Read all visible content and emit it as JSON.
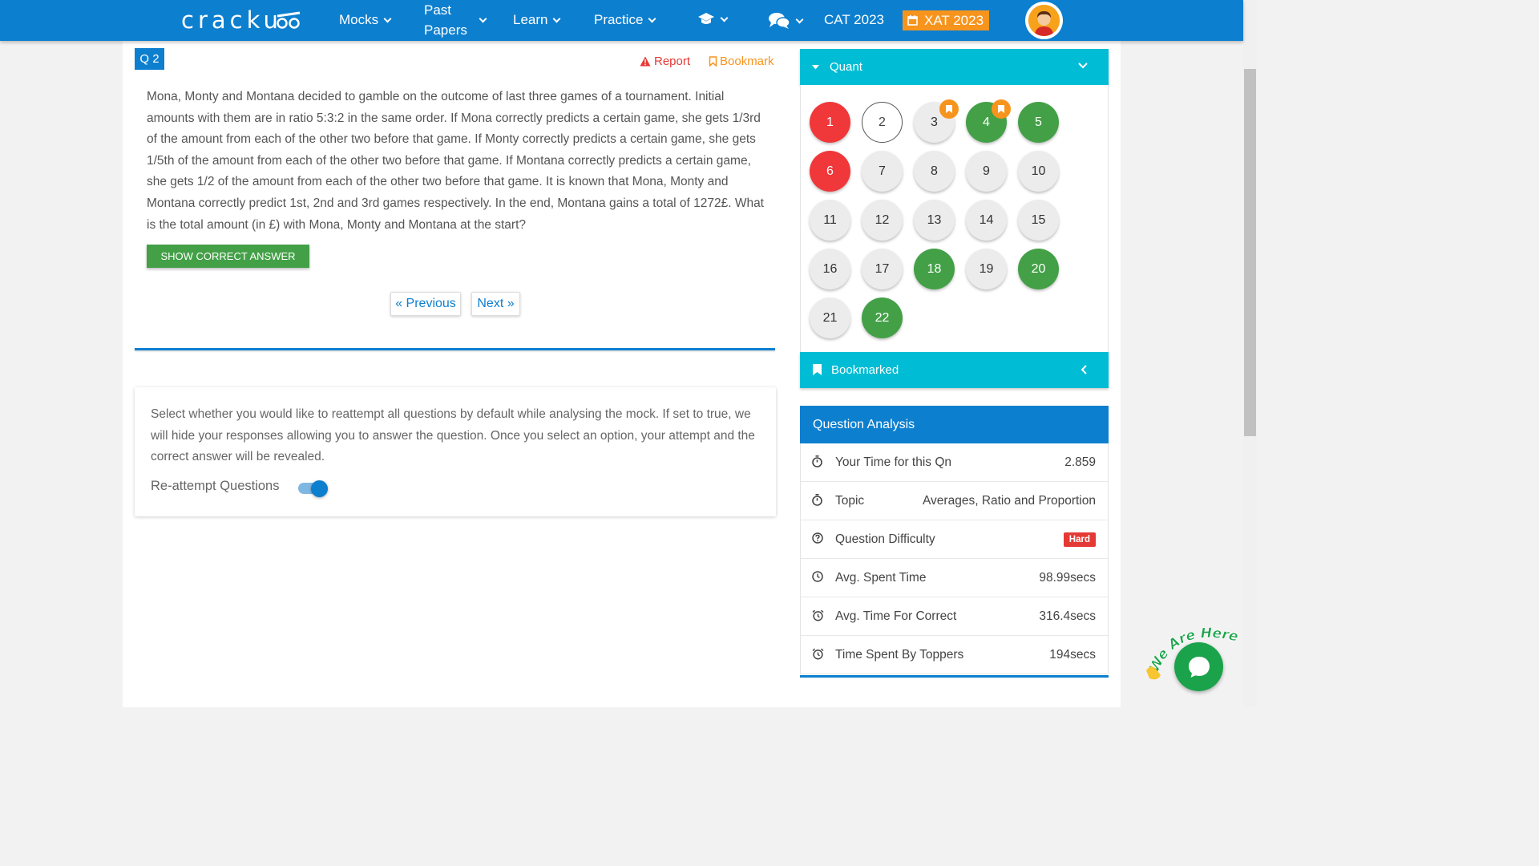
{
  "brand": {
    "name": "cracku"
  },
  "nav": {
    "mocks": "Mocks",
    "past_papers_line1": "Past",
    "past_papers_line2": "Papers",
    "learn": "Learn",
    "practice": "Practice",
    "cat": "CAT 2023",
    "xat": "XAT 2023"
  },
  "question": {
    "badge": "Q 2",
    "report": "Report",
    "bookmark": "Bookmark",
    "text": "Mona, Monty and Montana decided to gamble on the outcome of last three games of a tournament. Initial amounts with them are in ratio 5:3:2 in the same order. If Mona correctly predicts a certain game, she gets 1/3rd of the amount from each of the other two before that game. If Monty correctly predicts a certain game, she gets 1/5th of the amount from each of the other two before that game. If Montana correctly predicts a certain game, she gets 1/2 of the amount from each of the other two before that game. It is known that Mona, Monty and Montana correctly predict 1st, 2nd and 3rd games respectively. In the end, Montana gains a total of 1272£. What is the total amount (in £) with Mona, Monty and Montana at the start?",
    "show_answer": "SHOW CORRECT ANSWER",
    "previous": "« Previous",
    "next": "Next »"
  },
  "reattempt": {
    "text": "Select whether you would like to reattempt all questions by default while analysing the mock. If set to true, we will hide your responses allowing you to answer the question. Once you select an option, your attempt and the correct answer will be revealed.",
    "label": "Re-attempt Questions",
    "enabled": true
  },
  "panel": {
    "section": "Quant",
    "bookmarked": "Bookmarked",
    "questions": [
      {
        "n": "1",
        "state": "red"
      },
      {
        "n": "2",
        "state": "current"
      },
      {
        "n": "3",
        "state": "grey",
        "bookmarked": true
      },
      {
        "n": "4",
        "state": "green",
        "bookmarked": true
      },
      {
        "n": "5",
        "state": "green"
      },
      {
        "n": "6",
        "state": "red"
      },
      {
        "n": "7",
        "state": "grey"
      },
      {
        "n": "8",
        "state": "grey"
      },
      {
        "n": "9",
        "state": "grey"
      },
      {
        "n": "10",
        "state": "grey"
      },
      {
        "n": "11",
        "state": "grey"
      },
      {
        "n": "12",
        "state": "grey"
      },
      {
        "n": "13",
        "state": "grey"
      },
      {
        "n": "14",
        "state": "grey"
      },
      {
        "n": "15",
        "state": "grey"
      },
      {
        "n": "16",
        "state": "grey"
      },
      {
        "n": "17",
        "state": "grey"
      },
      {
        "n": "18",
        "state": "green"
      },
      {
        "n": "19",
        "state": "grey"
      },
      {
        "n": "20",
        "state": "green"
      },
      {
        "n": "21",
        "state": "grey"
      },
      {
        "n": "22",
        "state": "green"
      }
    ]
  },
  "analysis": {
    "title": "Question Analysis",
    "rows": [
      {
        "icon": "stopwatch-icon",
        "label": "Your Time for this Qn",
        "value": "2.859"
      },
      {
        "icon": "stopwatch-icon",
        "label": "Topic",
        "value": "Averages, Ratio and Proportion"
      },
      {
        "icon": "help-circle-icon",
        "label": "Question Difficulty",
        "value": "Hard"
      },
      {
        "icon": "clock-icon",
        "label": "Avg. Spent Time",
        "value": "98.99secs"
      },
      {
        "icon": "alarm-icon",
        "label": "Avg. Time For Correct",
        "value": "316.4secs"
      },
      {
        "icon": "alarm-icon",
        "label": "Time Spent By Toppers",
        "value": "194secs"
      }
    ]
  },
  "chat": {
    "tagline": "We Are Here!"
  },
  "colors": {
    "primary": "#0d7fcf",
    "panel_header": "#00bcd4",
    "correct": "#43a047",
    "wrong": "#f0373a",
    "accent": "#f7941d",
    "hard": "#e53935"
  }
}
